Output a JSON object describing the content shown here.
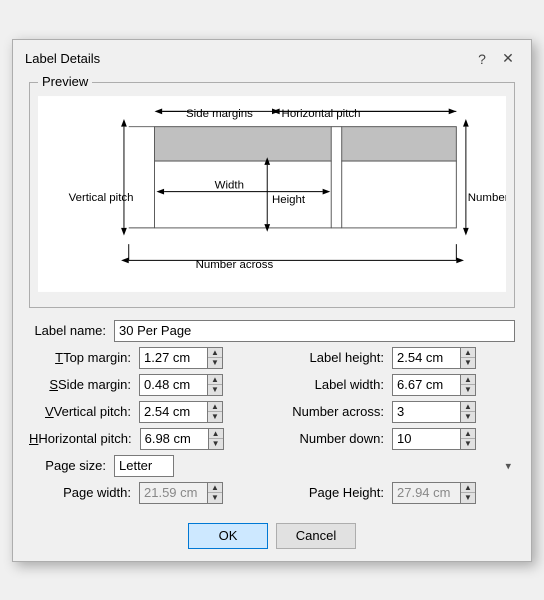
{
  "dialog": {
    "title": "Label Details",
    "help_btn": "?",
    "close_btn": "✕"
  },
  "preview": {
    "legend": "Preview"
  },
  "form": {
    "label_name_label": "Label name:",
    "label_name_value": "30 Per Page",
    "top_margin_label": "Top margin:",
    "top_margin_value": "1.27 cm",
    "side_margin_label": "Side margin:",
    "side_margin_value": "0.48 cm",
    "vertical_pitch_label": "Vertical pitch:",
    "vertical_pitch_value": "2.54 cm",
    "horizontal_pitch_label": "Horizontal pitch:",
    "horizontal_pitch_value": "6.98 cm",
    "page_size_label": "Page size:",
    "page_size_value": "Letter",
    "page_width_label": "Page width:",
    "page_width_value": "21.59 cm",
    "label_height_label": "Label height:",
    "label_height_value": "2.54 cm",
    "label_width_label": "Label width:",
    "label_width_value": "6.67 cm",
    "number_across_label": "Number across:",
    "number_across_value": "3",
    "number_down_label": "Number down:",
    "number_down_value": "10",
    "page_height_label": "Page Height:",
    "page_height_value": "27.94 cm"
  },
  "buttons": {
    "ok": "OK",
    "cancel": "Cancel"
  }
}
